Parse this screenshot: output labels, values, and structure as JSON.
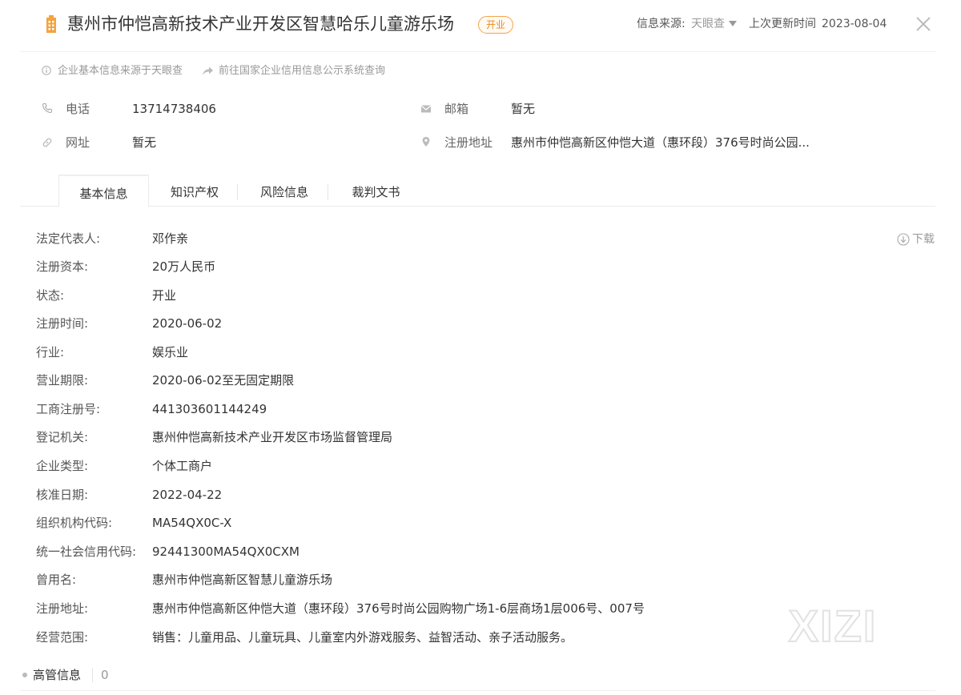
{
  "header": {
    "title": "惠州市仲恺高新技术产业开发区智慧哈乐儿童游乐场",
    "status_tag": "开业",
    "source_label": "信息来源:",
    "source_value": "天眼查",
    "update_label": "上次更新时间",
    "update_time": "2023-08-04"
  },
  "notes": {
    "basic_info_source": "企业基本信息来源于天眼查",
    "goto_national": "前往国家企业信用信息公示系统查询"
  },
  "contact": {
    "phone_label": "电话",
    "phone_value": "13714738406",
    "email_label": "邮箱",
    "email_value": "暂无",
    "website_label": "网址",
    "website_value": "暂无",
    "address_label": "注册地址",
    "address_value": "惠州市仲恺高新区仲恺大道（惠环段）376号时尚公园..."
  },
  "tabs": [
    {
      "label": "基本信息"
    },
    {
      "label": "知识产权"
    },
    {
      "label": "风险信息"
    },
    {
      "label": "裁判文书"
    }
  ],
  "download_label": "下载",
  "details": [
    {
      "label": "法定代表人:",
      "value": "邓作亲"
    },
    {
      "label": "注册资本:",
      "value": "20万人民币"
    },
    {
      "label": "状态:",
      "value": "开业"
    },
    {
      "label": "注册时间:",
      "value": "2020-06-02"
    },
    {
      "label": "行业:",
      "value": "娱乐业"
    },
    {
      "label": "营业期限:",
      "value": "2020-06-02至无固定期限"
    },
    {
      "label": "工商注册号:",
      "value": "441303601144249"
    },
    {
      "label": "登记机关:",
      "value": "惠州仲恺高新技术产业开发区市场监督管理局"
    },
    {
      "label": "企业类型:",
      "value": "个体工商户"
    },
    {
      "label": "核准日期:",
      "value": "2022-04-22"
    },
    {
      "label": "组织机构代码:",
      "value": "MA54QX0C-X"
    },
    {
      "label": "统一社会信用代码:",
      "value": "92441300MA54QX0CXM"
    },
    {
      "label": "曾用名:",
      "value": "惠州市仲恺高新区智慧儿童游乐场"
    },
    {
      "label": "注册地址:",
      "value": "惠州市仲恺高新区仲恺大道（惠环段）376号时尚公园购物广场1-6层商场1层006号、007号"
    },
    {
      "label": "经营范围:",
      "value": "销售：儿童用品、儿童玩具、儿童室内外游戏服务、益智活动、亲子活动服务。"
    }
  ],
  "executives": {
    "label": "高管信息",
    "count": "0"
  },
  "watermark": "XIZI",
  "colors": {
    "accent_orange": "#e8891e",
    "icon_orange": "#f4a340",
    "text_gray": "#999999"
  },
  "icons": {
    "building": "building-icon",
    "close": "close-icon",
    "phone": "phone-icon",
    "email": "mail-icon",
    "link": "link-icon",
    "location": "location-pin-icon",
    "download": "download-icon"
  }
}
